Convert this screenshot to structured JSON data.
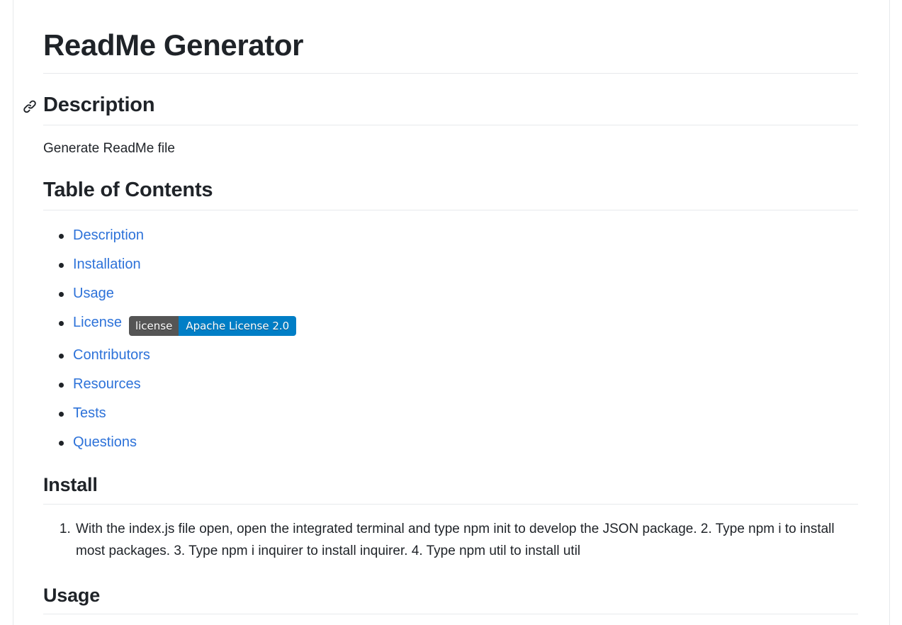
{
  "document": {
    "title": "ReadMe Generator",
    "sections": {
      "description": {
        "heading": "Description",
        "anchor_icon": "link-icon",
        "body": "Generate ReadMe file"
      },
      "table_of_contents": {
        "heading": "Table of Contents",
        "items": [
          {
            "label": "Description"
          },
          {
            "label": "Installation"
          },
          {
            "label": "Usage"
          },
          {
            "label": "License"
          },
          {
            "label": "Contributors"
          },
          {
            "label": "Resources"
          },
          {
            "label": "Tests"
          },
          {
            "label": "Questions"
          }
        ]
      },
      "install": {
        "heading": "Install",
        "steps": [
          "With the index.js file open, open the integrated terminal and type npm init to develop the JSON package. 2. Type npm i to install most packages. 3. Type npm i inquirer to install inquirer. 4. Type npm util to install util"
        ]
      },
      "usage": {
        "heading": "Usage"
      }
    },
    "license_badge": {
      "label": "license",
      "value": "Apache License 2.0",
      "label_color": "#555555",
      "value_color": "#007ec6",
      "text_color": "#ffffff"
    }
  },
  "theme": {
    "background": "#ffffff",
    "text_color": "#1f2328",
    "link_color": "#2d72d9",
    "rule_color": "#e7e9ec",
    "frame_border": "#e7e9ec"
  }
}
